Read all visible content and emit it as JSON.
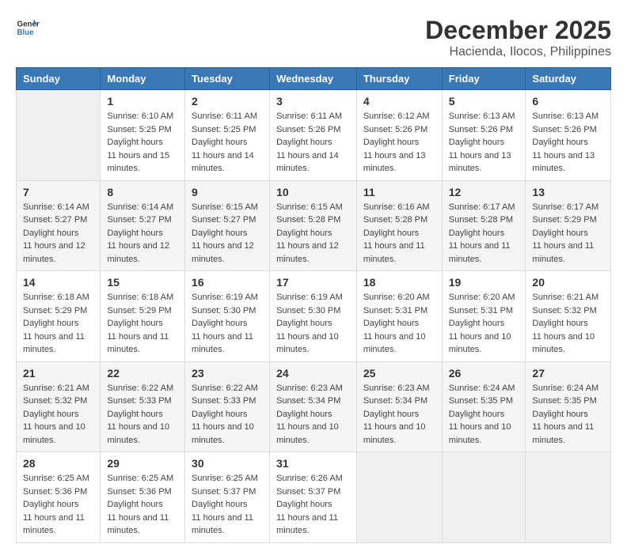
{
  "header": {
    "logo_line1": "General",
    "logo_line2": "Blue",
    "month": "December 2025",
    "location": "Hacienda, Ilocos, Philippines"
  },
  "weekdays": [
    "Sunday",
    "Monday",
    "Tuesday",
    "Wednesday",
    "Thursday",
    "Friday",
    "Saturday"
  ],
  "weeks": [
    [
      {
        "day": "",
        "empty": true
      },
      {
        "day": "1",
        "sunrise": "6:10 AM",
        "sunset": "5:25 PM",
        "daylight": "11 hours and 15 minutes."
      },
      {
        "day": "2",
        "sunrise": "6:11 AM",
        "sunset": "5:25 PM",
        "daylight": "11 hours and 14 minutes."
      },
      {
        "day": "3",
        "sunrise": "6:11 AM",
        "sunset": "5:26 PM",
        "daylight": "11 hours and 14 minutes."
      },
      {
        "day": "4",
        "sunrise": "6:12 AM",
        "sunset": "5:26 PM",
        "daylight": "11 hours and 13 minutes."
      },
      {
        "day": "5",
        "sunrise": "6:13 AM",
        "sunset": "5:26 PM",
        "daylight": "11 hours and 13 minutes."
      },
      {
        "day": "6",
        "sunrise": "6:13 AM",
        "sunset": "5:26 PM",
        "daylight": "11 hours and 13 minutes."
      }
    ],
    [
      {
        "day": "7",
        "sunrise": "6:14 AM",
        "sunset": "5:27 PM",
        "daylight": "11 hours and 12 minutes."
      },
      {
        "day": "8",
        "sunrise": "6:14 AM",
        "sunset": "5:27 PM",
        "daylight": "11 hours and 12 minutes."
      },
      {
        "day": "9",
        "sunrise": "6:15 AM",
        "sunset": "5:27 PM",
        "daylight": "11 hours and 12 minutes."
      },
      {
        "day": "10",
        "sunrise": "6:15 AM",
        "sunset": "5:28 PM",
        "daylight": "11 hours and 12 minutes."
      },
      {
        "day": "11",
        "sunrise": "6:16 AM",
        "sunset": "5:28 PM",
        "daylight": "11 hours and 11 minutes."
      },
      {
        "day": "12",
        "sunrise": "6:17 AM",
        "sunset": "5:28 PM",
        "daylight": "11 hours and 11 minutes."
      },
      {
        "day": "13",
        "sunrise": "6:17 AM",
        "sunset": "5:29 PM",
        "daylight": "11 hours and 11 minutes."
      }
    ],
    [
      {
        "day": "14",
        "sunrise": "6:18 AM",
        "sunset": "5:29 PM",
        "daylight": "11 hours and 11 minutes."
      },
      {
        "day": "15",
        "sunrise": "6:18 AM",
        "sunset": "5:29 PM",
        "daylight": "11 hours and 11 minutes."
      },
      {
        "day": "16",
        "sunrise": "6:19 AM",
        "sunset": "5:30 PM",
        "daylight": "11 hours and 11 minutes."
      },
      {
        "day": "17",
        "sunrise": "6:19 AM",
        "sunset": "5:30 PM",
        "daylight": "11 hours and 10 minutes."
      },
      {
        "day": "18",
        "sunrise": "6:20 AM",
        "sunset": "5:31 PM",
        "daylight": "11 hours and 10 minutes."
      },
      {
        "day": "19",
        "sunrise": "6:20 AM",
        "sunset": "5:31 PM",
        "daylight": "11 hours and 10 minutes."
      },
      {
        "day": "20",
        "sunrise": "6:21 AM",
        "sunset": "5:32 PM",
        "daylight": "11 hours and 10 minutes."
      }
    ],
    [
      {
        "day": "21",
        "sunrise": "6:21 AM",
        "sunset": "5:32 PM",
        "daylight": "11 hours and 10 minutes."
      },
      {
        "day": "22",
        "sunrise": "6:22 AM",
        "sunset": "5:33 PM",
        "daylight": "11 hours and 10 minutes."
      },
      {
        "day": "23",
        "sunrise": "6:22 AM",
        "sunset": "5:33 PM",
        "daylight": "11 hours and 10 minutes."
      },
      {
        "day": "24",
        "sunrise": "6:23 AM",
        "sunset": "5:34 PM",
        "daylight": "11 hours and 10 minutes."
      },
      {
        "day": "25",
        "sunrise": "6:23 AM",
        "sunset": "5:34 PM",
        "daylight": "11 hours and 10 minutes."
      },
      {
        "day": "26",
        "sunrise": "6:24 AM",
        "sunset": "5:35 PM",
        "daylight": "11 hours and 10 minutes."
      },
      {
        "day": "27",
        "sunrise": "6:24 AM",
        "sunset": "5:35 PM",
        "daylight": "11 hours and 11 minutes."
      }
    ],
    [
      {
        "day": "28",
        "sunrise": "6:25 AM",
        "sunset": "5:36 PM",
        "daylight": "11 hours and 11 minutes."
      },
      {
        "day": "29",
        "sunrise": "6:25 AM",
        "sunset": "5:36 PM",
        "daylight": "11 hours and 11 minutes."
      },
      {
        "day": "30",
        "sunrise": "6:25 AM",
        "sunset": "5:37 PM",
        "daylight": "11 hours and 11 minutes."
      },
      {
        "day": "31",
        "sunrise": "6:26 AM",
        "sunset": "5:37 PM",
        "daylight": "11 hours and 11 minutes."
      },
      {
        "day": "",
        "empty": true
      },
      {
        "day": "",
        "empty": true
      },
      {
        "day": "",
        "empty": true
      }
    ]
  ],
  "labels": {
    "sunrise": "Sunrise:",
    "sunset": "Sunset:",
    "daylight": "Daylight:"
  }
}
